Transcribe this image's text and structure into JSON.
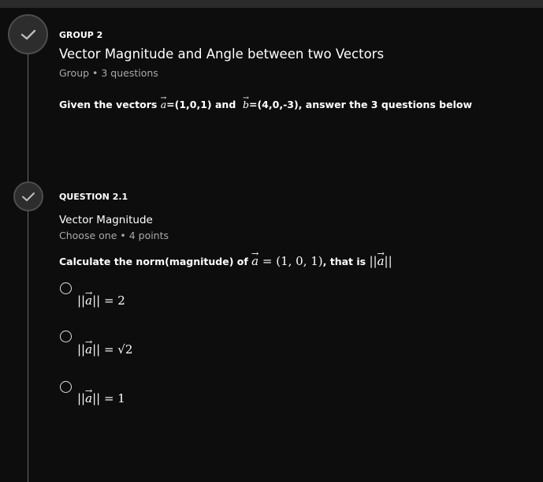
{
  "group": {
    "eyebrow": "GROUP 2",
    "title": "Vector Magnitude and Angle between two Vectors",
    "meta": "Group • 3 questions",
    "prompt": {
      "pre": "Given  the vectors ",
      "vec_a": "a",
      "a_value": "=(1,0,1) and ",
      "vec_b": "b",
      "b_value": "=(4,0,-3), answer the 3 questions below"
    },
    "status_icon": "check-icon"
  },
  "question": {
    "eyebrow": "QUESTION 2.1",
    "title": "Vector Magnitude",
    "meta": "Choose one • 4 points",
    "prompt": {
      "pre": "Calculate the norm(magnitude) of ",
      "vec": "a",
      "eq": " = (1, 0, 1)",
      "mid": ", that is ",
      "norm_open": "||",
      "norm_close": "||"
    },
    "status_icon": "check-icon",
    "options": [
      {
        "norm_open": "||",
        "vec": "a",
        "norm_close": "||",
        "rhs": " = 2",
        "selected": false
      },
      {
        "norm_open": "||",
        "vec": "a",
        "norm_close": "||",
        "rhs": " = √2",
        "selected": false
      },
      {
        "norm_open": "||",
        "vec": "a",
        "norm_close": "||",
        "rhs": " = 1",
        "selected": false
      }
    ]
  }
}
